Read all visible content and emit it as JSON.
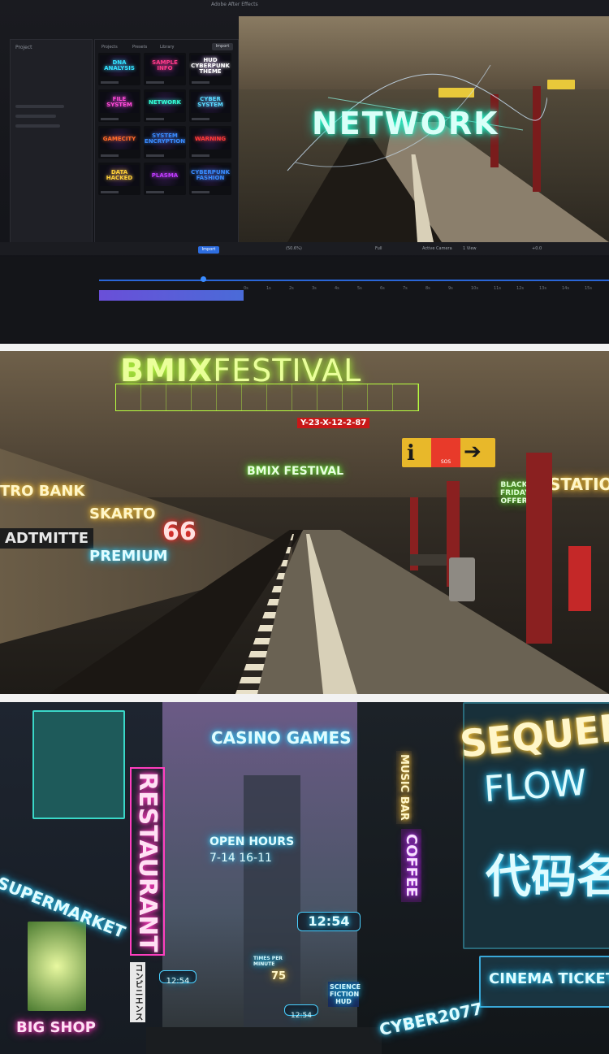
{
  "editor": {
    "app_title": "Adobe After Effects",
    "project_label": "Project",
    "browser_tabs": [
      "Projects",
      "Presets",
      "Library"
    ],
    "import_label": "Import",
    "thumbnails": [
      {
        "label": "DNA ANALYSIS",
        "color": "#34e0ff"
      },
      {
        "label": "SAMPLE INFO",
        "color": "#ff3a8a"
      },
      {
        "label": "HUD CYBERPUNK THEME",
        "color": "#ffffff"
      },
      {
        "label": "FILE SYSTEM",
        "color": "#ff4ad8"
      },
      {
        "label": "NETWORK",
        "color": "#34ffd8"
      },
      {
        "label": "CYBER SYSTEM",
        "color": "#5ad8ff"
      },
      {
        "label": "GAMECITY",
        "color": "#ff6a2a"
      },
      {
        "label": "SYSTEM ENCRYPTION",
        "color": "#3a8bff"
      },
      {
        "label": "WARNING",
        "color": "#ff3a3a"
      },
      {
        "label": "DATA HACKED",
        "color": "#ffd03a"
      },
      {
        "label": "PLASMA",
        "color": "#c03aff"
      },
      {
        "label": "CYBERPUNK FASHION",
        "color": "#3a8bff"
      }
    ],
    "viewer_text": "NETWORK",
    "toolbar": {
      "zoom": "(50.6%)",
      "resolution": "Full",
      "camera": "Active Camera",
      "views": "1 View",
      "exposure": "+0.0"
    },
    "timeline_ticks": [
      "0s",
      "1s",
      "2s",
      "3s",
      "4s",
      "5s",
      "6s",
      "7s",
      "8s",
      "9s",
      "10s",
      "11s",
      "12s",
      "13s",
      "14s",
      "15s"
    ]
  },
  "subway": {
    "title_bold": "BMIX",
    "title_thin": "FESTIVAL",
    "date_code": "Y-23-X-12-2-87",
    "sign_bmix_small": "BMIX FESTIVAL",
    "info_sos": "SOS",
    "bank": "TRO BANK",
    "station_name": "ADTMITTE",
    "skarto": "SKARTO",
    "premium": "PREMIUM",
    "number": "66",
    "black_friday": "BLACK FRIDAY OFFER",
    "station_f": "STATION F"
  },
  "city": {
    "casino": "CASINO GAMES",
    "restaurant": "RESTAURANT",
    "open_hours_title": "OPEN HOURS",
    "open_hours_value": "7-14 16-11",
    "supermarket": "SUPERMARKET",
    "big_shop": "BIG SHOP",
    "music_bar": "MUSIC BAR",
    "coffee": "COFFEE",
    "sequence": "SEQUENC",
    "flow": "FLOW",
    "chinese": "代码名",
    "cinema": "CINEMA TICKET",
    "cyber": "CYBER2077",
    "clock_main": "12:54",
    "clock_small": "12:54",
    "clock_tiny": "12:54",
    "times_label": "TIMES PER MINUTE",
    "times_value": "75",
    "science": "SCIENCE FICTION HUD",
    "katakana": "コンビニエンス"
  }
}
